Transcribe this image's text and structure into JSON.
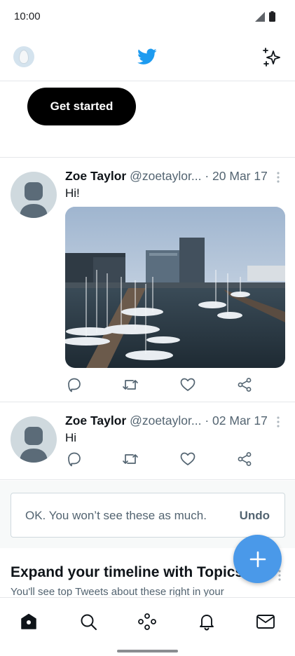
{
  "status_bar": {
    "time": "10:00"
  },
  "top_bar": {
    "logo": "twitter-bird-icon",
    "left": "profile-avatar",
    "right": "sparkle-icon"
  },
  "cta": {
    "label": "Get started"
  },
  "tweets": [
    {
      "name": "Zoe Taylor",
      "handle": "@zoetaylor...",
      "date": "· 20 Mar 17",
      "text": "Hi!",
      "has_photo": true
    },
    {
      "name": "Zoe Taylor",
      "handle": "@zoetaylor...",
      "date": "· 02 Mar 17",
      "text": "Hi",
      "has_photo": false
    }
  ],
  "notice": {
    "text": "OK. You won’t see these as much.",
    "undo_label": "Undo"
  },
  "topics": {
    "title": "Expand your timeline with Topics",
    "subtitle": "You'll see top Tweets about these right in your"
  },
  "colors": {
    "brand": "#1d9bf0",
    "fab": "#4a99e9",
    "button": "#000000"
  },
  "nav": [
    "home-icon",
    "search-icon",
    "spaces-icon",
    "notifications-icon",
    "messages-icon"
  ]
}
